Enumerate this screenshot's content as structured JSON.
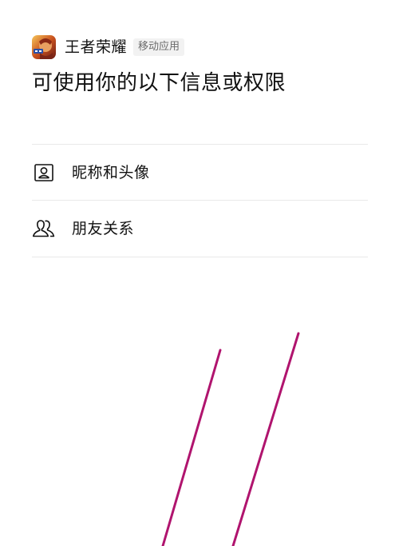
{
  "app": {
    "name": "王者荣耀",
    "badge": "移动应用"
  },
  "title": "可使用你的以下信息或权限",
  "permissions": [
    {
      "label": "昵称和头像",
      "icon": "profile-card-icon"
    },
    {
      "label": "朋友关系",
      "icon": "friends-icon"
    }
  ],
  "colors": {
    "accent_lines": "#b0146e",
    "divider": "#e9e9e9",
    "badge_bg": "#f2f2f2"
  }
}
